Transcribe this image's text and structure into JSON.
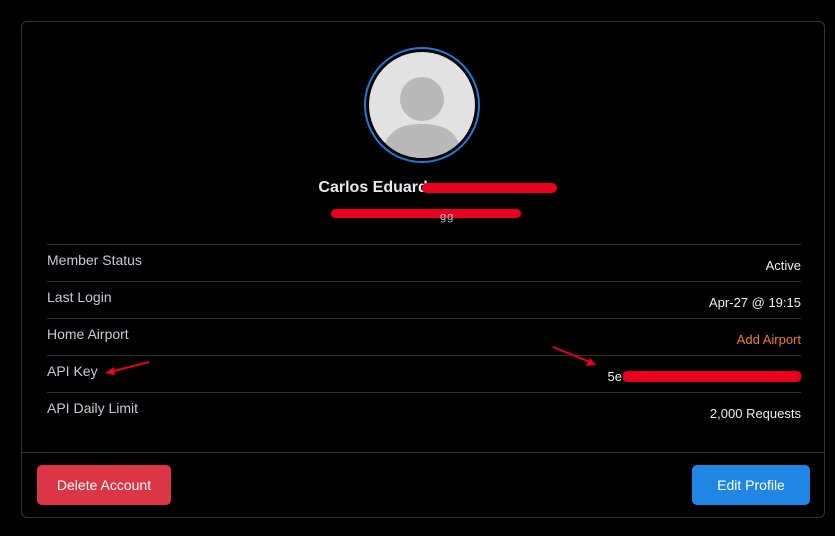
{
  "profile": {
    "name": "Carlos Eduardo",
    "subtitle_tail": "gg"
  },
  "details": {
    "rows": [
      {
        "label": "Member Status",
        "value": "Active"
      },
      {
        "label": "Last Login",
        "value": "Apr-27 @ 19:15"
      },
      {
        "label": "Home Airport",
        "value": "Add Airport"
      },
      {
        "label": "API Key",
        "value": "5e"
      },
      {
        "label": "API Daily Limit",
        "value": "2,000 Requests"
      }
    ]
  },
  "actions": {
    "delete_label": "Delete Account",
    "edit_label": "Edit Profile"
  },
  "colors": {
    "background": "#000000",
    "avatar_ring": "#1e7ad6",
    "link": "#f07d2b",
    "danger": "#dc3545",
    "primary": "#1f86e3",
    "redaction": "#e8001e"
  },
  "icons": [
    "user-silhouette-icon",
    "annotation-arrow-icon"
  ]
}
